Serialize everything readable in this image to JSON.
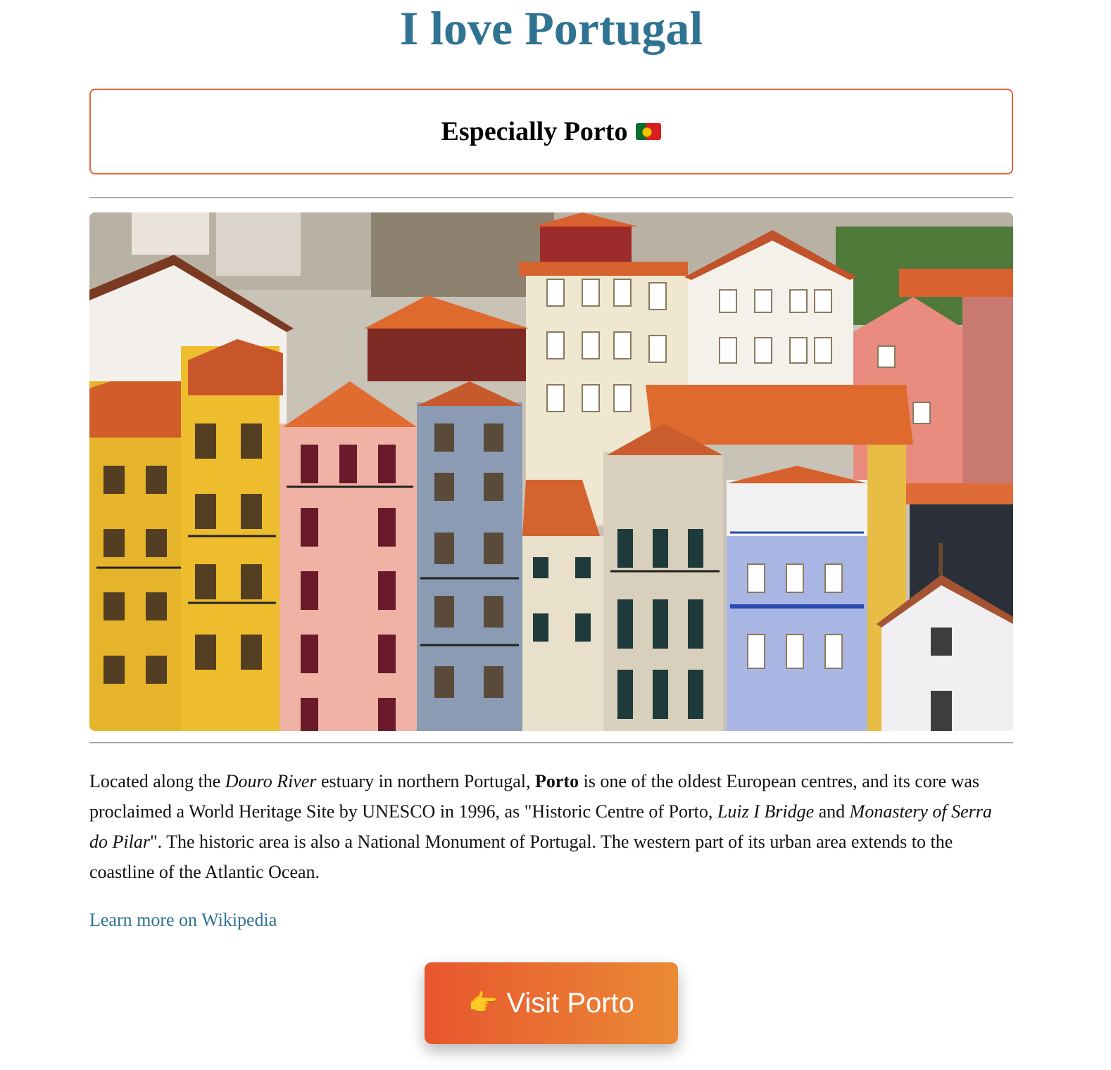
{
  "page": {
    "title": "I love Portugal",
    "subtitle": "Especially Porto",
    "subtitle_flag_icon": "portugal-flag-icon"
  },
  "hero_image": {
    "icon": "porto-riverside-houses-photo"
  },
  "description": {
    "p1": "Located along the ",
    "river": "Douro River",
    "p2": " estuary in northern Portugal, ",
    "city": "Porto",
    "p3": " is one of the oldest European centres, and its core was proclaimed a World Heritage Site by UNESCO in 1996, as \"Historic Centre of Porto, ",
    "bridge": "Luiz I Bridge",
    "p4": " and ",
    "monastery": "Monastery of Serra do Pilar",
    "p5": "\". The historic area is also a National Monument of Portugal. The western part of its urban area extends to the coastline of the Atlantic Ocean."
  },
  "links": {
    "wikipedia": "Learn more on Wikipedia"
  },
  "cta": {
    "icon": "pointing-hand-icon",
    "icon_glyph": "👉",
    "label": "Visit Porto"
  },
  "colors": {
    "title": "#2f7393",
    "accent_border": "#e8643a",
    "button_start": "#e8562e",
    "button_end": "#ea8a35",
    "link": "#2f7393"
  }
}
